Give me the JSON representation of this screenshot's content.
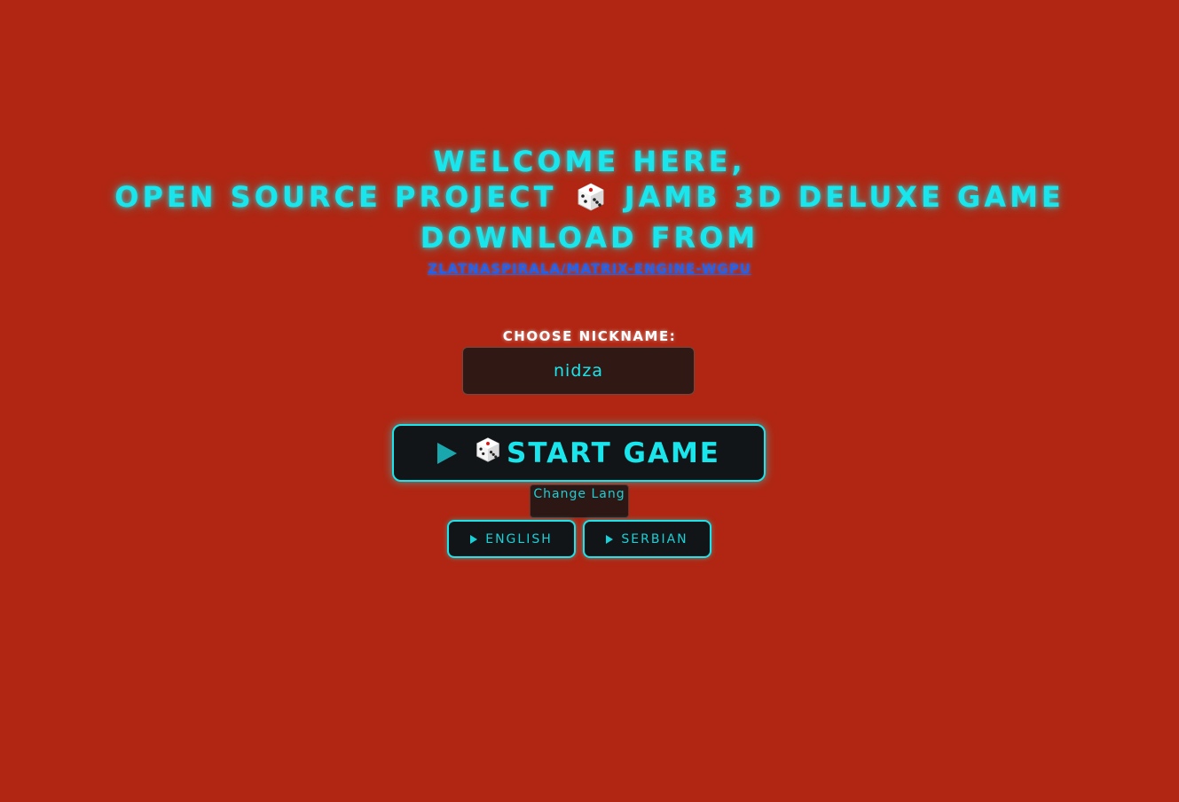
{
  "header": {
    "line1": "WELCOME HERE,",
    "line2_before": "OPEN SOURCE PROJECT",
    "line2_after": "JAMB 3D DELUXE GAME",
    "line3": "DOWNLOAD FROM",
    "link_text": "ZLATNASPIRALA/MATRIX-ENGINE-WGPU"
  },
  "nickname": {
    "label": "CHOOSE NICKNAME:",
    "value": "nidza"
  },
  "start_button": {
    "label": "START GAME"
  },
  "language": {
    "change_label": "Change Lang",
    "options": [
      "ENGLISH",
      "SERBIAN"
    ]
  },
  "colors": {
    "background": "#b02612",
    "accent": "#19e6ec",
    "link": "#1e63f0"
  },
  "icons": {
    "die": "dice-icon",
    "play": "play-icon"
  }
}
